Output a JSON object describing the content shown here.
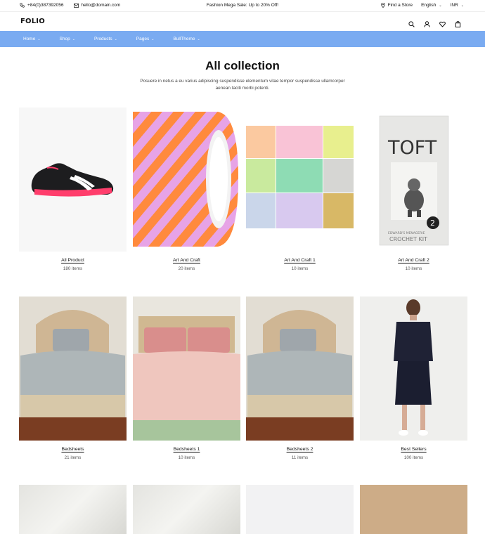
{
  "topbar": {
    "phone": "+84(0)387392056",
    "email": "hello@domain.com",
    "promo": "Fashion Mega Sale: Up to 20% Off!",
    "find_store": "Find a Store",
    "language": "English",
    "currency": "INR"
  },
  "header": {
    "logo": "FOLIO"
  },
  "nav": {
    "items": [
      {
        "label": "Home"
      },
      {
        "label": "Shop"
      },
      {
        "label": "Products"
      },
      {
        "label": "Pages"
      },
      {
        "label": "BullTheme"
      }
    ]
  },
  "page": {
    "title": "All collection",
    "description": "Posuere in netus a eu varius adipiscing suspendisse elementum vitae tempor suspendisse ullamcorper aenean taciti morbi potenti."
  },
  "collections": [
    {
      "name": "All Product",
      "count": "180 items"
    },
    {
      "name": "Art And Craft",
      "count": "20 items"
    },
    {
      "name": "Art And Craft 1",
      "count": "10 items"
    },
    {
      "name": "Art And Craft 2",
      "count": "10 items"
    },
    {
      "name": "Bedsheets",
      "count": "21 items"
    },
    {
      "name": "Bedsheets 1",
      "count": "10 items"
    },
    {
      "name": "Bedsheets 2",
      "count": "11 items"
    },
    {
      "name": "Best Sellers",
      "count": "100 items"
    }
  ],
  "kit_box": {
    "brand": "TOFT",
    "number": "2",
    "caption": "EDWARD'S MENAGERIE",
    "subtitle": "CROCHET KIT"
  },
  "colors": {
    "nav_bg": "#7aabf1",
    "text": "#111111"
  }
}
